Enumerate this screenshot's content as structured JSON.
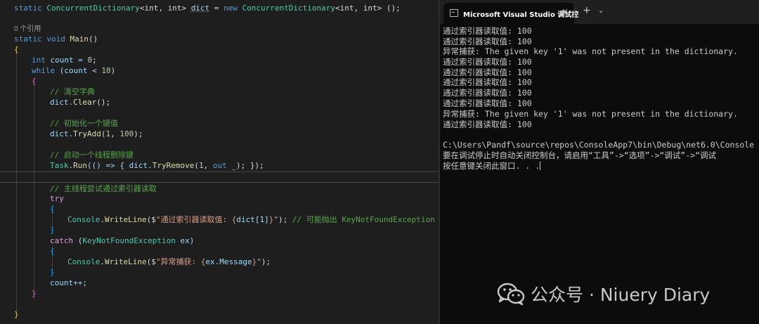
{
  "editor": {
    "reference_hint": "0 个引用",
    "code": {
      "field_static": "static",
      "field_type": "ConcurrentDictionary",
      "field_args": "<int, int> ",
      "field_name": "dict",
      "field_eq": " = ",
      "field_new": "new",
      "field_init": "();",
      "main_static": "static",
      "main_void": "void",
      "main_name": "Main",
      "main_parens": "()",
      "open_brace": "{",
      "close_brace": "}",
      "int_kw": "int",
      "count_decl": " count = ",
      "zero": "0",
      "semi": ";",
      "while_kw": "while",
      "while_cond_a": " (count < ",
      "ten": "10",
      "while_cond_b": ")",
      "comment_clear": "// 清空字典",
      "dict_dot": "dict.",
      "clear_fn": "Clear",
      "clear_tail": "();",
      "comment_init": "// 初始化一个键值",
      "tryadd_fn": "TryAdd",
      "paren_open": "(",
      "one": "1",
      "comma": ", ",
      "hundred": "100",
      "paren_close_semi": ");",
      "comment_thread": "// 启动一个线程删除键",
      "task_type": "Task",
      "dot": ".",
      "run_fn": "Run",
      "lambda": "(() => { dict.",
      "tryremove_fn": "TryRemove",
      "out_kw": "out",
      "discard": " _); });",
      "comment_main": "// 主线程尝试通过索引器读取",
      "try_kw": "try",
      "console_type": "Console",
      "writeline_fn": "WriteLine",
      "interp_open": "($",
      "str_read_a": "\"通过索引器读取值: {",
      "dict_index": "dict[1]",
      "str_read_b": "}\"",
      "call_end": ");",
      "comment_maybe": " // 可能抛出 KeyNotFoundException",
      "catch_kw": "catch",
      "catch_open": " (",
      "exception_type": "KeyNotFoundException",
      "catch_var": " ex)",
      "str_exc_a": "\"异常捕获: {",
      "ex_message": "ex.Message",
      "str_exc_b": "}\"",
      "count_inc": "count++;"
    }
  },
  "terminal": {
    "tab_title": "Microsoft Visual Studio 调试控",
    "close_glyph": "✕",
    "new_tab_glyph": "+",
    "dropdown_glyph": "⌄",
    "output": [
      "通过索引器读取值: 100",
      "通过索引器读取值: 100",
      "异常捕获: The given key '1' was not present in the dictionary.",
      "通过索引器读取值: 100",
      "通过索引器读取值: 100",
      "通过索引器读取值: 100",
      "通过索引器读取值: 100",
      "通过索引器读取值: 100",
      "异常捕获: The given key '1' was not present in the dictionary.",
      "通过索引器读取值: 100",
      "",
      "C:\\Users\\Pandf\\source\\repos\\ConsoleApp7\\bin\\Debug\\net6.0\\Console",
      "要在调试停止时自动关闭控制台，请启用“工具”->“选项”->“调试”->“调试",
      "按任意键关闭此窗口. . ."
    ]
  },
  "watermark": {
    "icon": "wechat-icon",
    "text": "公众号 · Niuery Diary"
  },
  "colors": {
    "editor_bg": "#1e1e1e",
    "terminal_bg": "#0c0c0c",
    "keyword": "#569cd6",
    "type": "#4ec9b0",
    "method": "#dcdcaa",
    "number": "#b5cea8",
    "string": "#d69d85",
    "comment": "#57a64a"
  }
}
